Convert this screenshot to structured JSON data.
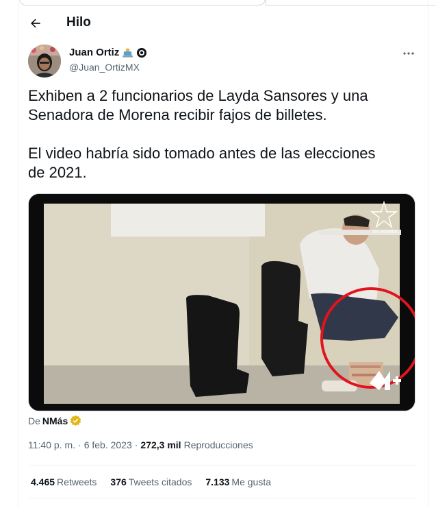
{
  "header": {
    "title": "Hilo"
  },
  "author": {
    "name": "Juan Ortiz",
    "handle": "@Juan_OrtizMX"
  },
  "tweet": {
    "text": "Exhiben a 2 funcionarios de Layda Sansores y una\nSenadora de Morena recibir fajos de billetes.\n\nEl video habría sido tomado antes de las elecciones\nde 2021."
  },
  "media": {
    "watermark_label": "las estrellas"
  },
  "source": {
    "prefix": "De",
    "name": "NMás"
  },
  "meta": {
    "time": "11:40 p. m.",
    "dot1": "·",
    "date": "6 feb. 2023",
    "dot2": "·",
    "views": "272,3 mil",
    "views_label": "Reproducciones"
  },
  "stats": {
    "retweets": "4.465",
    "retweets_label": "Retweets",
    "quotes": "376",
    "quotes_label": "Tweets citados",
    "likes": "7.133",
    "likes_label": "Me gusta"
  },
  "colors": {
    "text": "#0f1419",
    "secondary": "#536471",
    "verified_gold": "#e2b719",
    "highlight_circle": "#e0141c"
  },
  "icons": [
    "back-arrow-icon",
    "laptop-emoji-icon",
    "gray-verified-icon",
    "more-icon",
    "gold-verified-icon"
  ]
}
